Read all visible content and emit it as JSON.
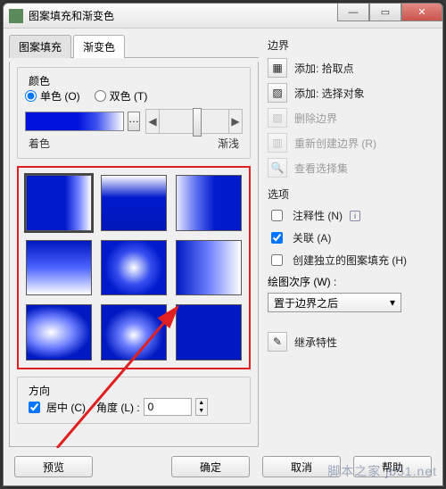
{
  "title": "图案填充和渐变色",
  "tabs": {
    "pattern": "图案填充",
    "gradient": "渐变色"
  },
  "color_group": {
    "label": "颜色",
    "single": "单色 (O)",
    "double": "双色 (T)",
    "shade": "着色",
    "lighter": "渐浅"
  },
  "direction_group": {
    "label": "方向",
    "centered": "居中 (C)",
    "angle": "角度 (L) :",
    "angle_val": "0"
  },
  "boundary": {
    "header": "边界",
    "add_pick": "添加: 拾取点",
    "add_select": "添加: 选择对象",
    "del": "删除边界",
    "recreate": "重新创建边界 (R)",
    "view_sel": "查看选择集"
  },
  "options": {
    "header": "选项",
    "annotative": "注释性 (N)",
    "assoc": "关联 (A)",
    "independent": "创建独立的图案填充 (H)",
    "draw_order_label": "绘图次序 (W) :",
    "draw_order_value": "置于边界之后"
  },
  "inherit": "继承特性",
  "buttons": {
    "preview": "预览",
    "ok": "确定",
    "cancel": "取消",
    "help": "帮助"
  },
  "watermark": "脚本之家 jb51.net"
}
